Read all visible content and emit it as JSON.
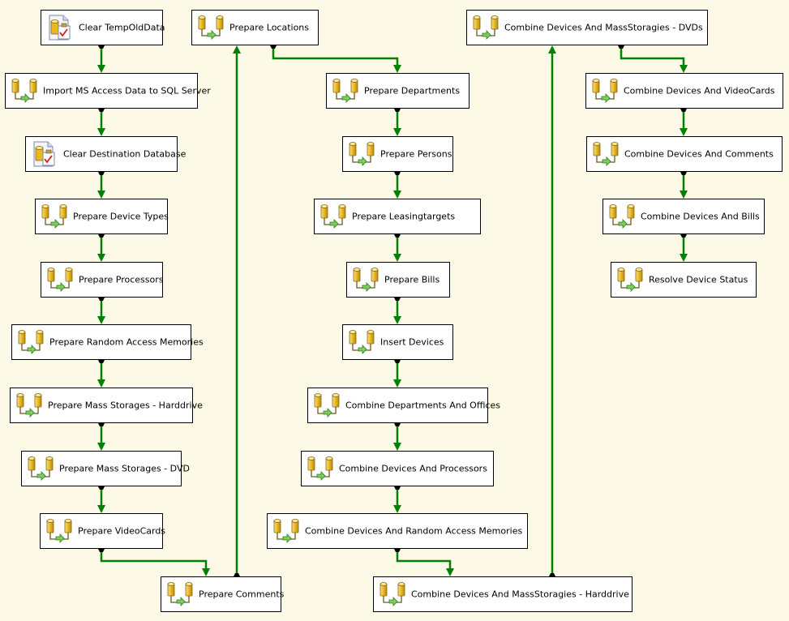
{
  "colors": {
    "background": "#fdf9e7",
    "success_constraint": "#008000",
    "task_border": "#000000"
  },
  "tasks": [
    {
      "label": "Clear TempOldData",
      "icon": "execute-sql-task-icon"
    },
    {
      "label": "Import MS Access Data to SQL Server",
      "icon": "data-flow-task-icon"
    },
    {
      "label": "Clear Destination Database",
      "icon": "execute-sql-task-icon"
    },
    {
      "label": "Prepare Device Types",
      "icon": "data-flow-task-icon"
    },
    {
      "label": "Prepare Processors",
      "icon": "data-flow-task-icon"
    },
    {
      "label": "Prepare Random Access Memories",
      "icon": "data-flow-task-icon"
    },
    {
      "label": "Prepare Mass Storages - Harddrive",
      "icon": "data-flow-task-icon"
    },
    {
      "label": "Prepare Mass Storages - DVD",
      "icon": "data-flow-task-icon"
    },
    {
      "label": "Prepare VideoCards",
      "icon": "data-flow-task-icon"
    },
    {
      "label": "Prepare Comments",
      "icon": "data-flow-task-icon"
    },
    {
      "label": "Prepare Locations",
      "icon": "data-flow-task-icon"
    },
    {
      "label": "Prepare Departments",
      "icon": "data-flow-task-icon"
    },
    {
      "label": "Prepare Persons",
      "icon": "data-flow-task-icon"
    },
    {
      "label": "Prepare Leasingtargets",
      "icon": "data-flow-task-icon"
    },
    {
      "label": "Prepare Bills",
      "icon": "data-flow-task-icon"
    },
    {
      "label": "Insert Devices",
      "icon": "data-flow-task-icon"
    },
    {
      "label": "Combine Departments And Offices",
      "icon": "data-flow-task-icon"
    },
    {
      "label": "Combine Devices And Processors",
      "icon": "data-flow-task-icon"
    },
    {
      "label": "Combine Devices And Random Access Memories",
      "icon": "data-flow-task-icon"
    },
    {
      "label": "Combine Devices And MassStoragies - Harddrive",
      "icon": "data-flow-task-icon"
    },
    {
      "label": "Combine Devices And MassStoragies - DVDs",
      "icon": "data-flow-task-icon"
    },
    {
      "label": "Combine Devices And VideoCards",
      "icon": "data-flow-task-icon"
    },
    {
      "label": "Combine Devices And Comments",
      "icon": "data-flow-task-icon"
    },
    {
      "label": "Combine Devices And Bills",
      "icon": "data-flow-task-icon"
    },
    {
      "label": "Resolve Device Status",
      "icon": "data-flow-task-icon"
    }
  ]
}
